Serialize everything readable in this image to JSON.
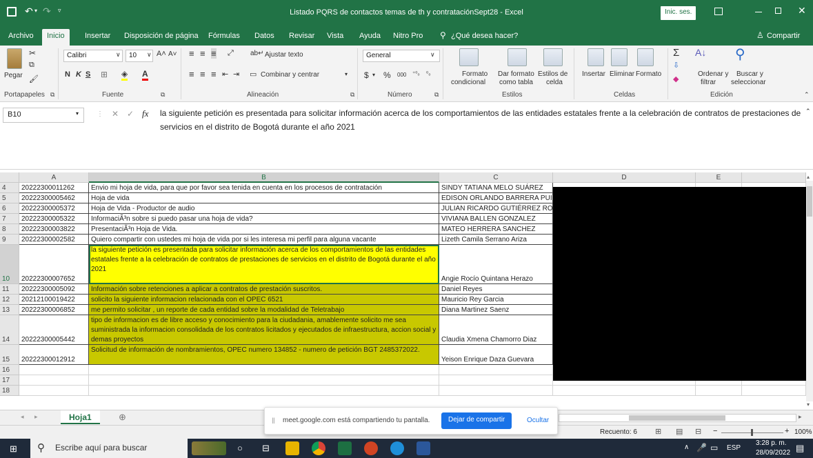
{
  "window": {
    "title": "Listado PQRS de contactos  temas de th y contrataciónSept28  -  Excel",
    "signin": "Inic. ses.",
    "share": "Compartir"
  },
  "tabs": [
    "Archivo",
    "Inicio",
    "Insertar",
    "Disposición de página",
    "Fórmulas",
    "Datos",
    "Revisar",
    "Vista",
    "Ayuda",
    "Nitro Pro",
    "¿Qué desea hacer?"
  ],
  "ribbon": {
    "paste": "Pegar",
    "font_name": "Calibri",
    "font_size": "10",
    "bold": "N",
    "italic": "K",
    "underline": "S",
    "wrap_text": "Ajustar texto",
    "merge_center": "Combinar y centrar",
    "number_format": "General",
    "currency": "$",
    "percent": "%",
    "thousands": "000",
    "cond_format": [
      "Formato",
      "condicional"
    ],
    "table_format": [
      "Dar formato",
      "como tabla"
    ],
    "cell_styles": [
      "Estilos de",
      "celda"
    ],
    "insert": "Insertar",
    "delete": "Eliminar",
    "format": "Formato",
    "sort": [
      "Ordenar y",
      "filtrar"
    ],
    "find": [
      "Buscar y",
      "seleccionar"
    ],
    "groups": [
      "Portapapeles",
      "Fuente",
      "Alineación",
      "Número",
      "Estilos",
      "Celdas",
      "Edición"
    ]
  },
  "formula_bar": {
    "name_box": "B10",
    "fx": "fx",
    "content": "la siguiente petición es presentada para solicitar información acerca de los comportamientos de las entidades estatales frente a la celebración de contratos de prestaciones de servicios en el distrito de Bogotá durante el año 2021"
  },
  "grid": {
    "columns": [
      "A",
      "B",
      "C",
      "D",
      "E"
    ],
    "rows": [
      {
        "n": "4",
        "a": "20222300011262",
        "b": "Envio mi hoja de vida, para que por favor sea tenida en cuenta en los procesos de contratación",
        "c": "SINDY TATIANA MELO SUÁREZ"
      },
      {
        "n": "5",
        "a": "20222300005462",
        "b": "Hoja de vida",
        "c": "EDISON ORLANDO BARRERA PUIN"
      },
      {
        "n": "6",
        "a": "20222300005372",
        "b": "Hoja de Vida - Productor de audio",
        "c": "JULIAN RICARDO GUTIÉRREZ RODRÍ"
      },
      {
        "n": "7",
        "a": "20222300005322",
        "b": "InformaciÃ³n sobre si puedo pasar una hoja de vida?",
        "c": "VIVIANA BALLEN GONZALEZ"
      },
      {
        "n": "8",
        "a": "20222300003822",
        "b": "PresentaciÃ³n Hoja de Vida.",
        "c": "MATEO HERRERA SANCHEZ"
      },
      {
        "n": "9",
        "a": "20222300002582",
        "b": "Quiero compartir con ustedes mi hoja de vida por si les interesa mi perfil para alguna vacante",
        "c": "Lizeth Camila Serrano Ariza"
      },
      {
        "n": "10",
        "a": "20222300007652",
        "b": "la siguiente petición es presentada para solicitar información acerca de los comportamientos de las entidades estatales frente a la celebración de contratos de prestaciones de servicios en el distrito de Bogotá durante el año 2021",
        "c": "Angie Rocío Quintana Herazo"
      },
      {
        "n": "11",
        "a": "20222300005092",
        "b": "Información sobre retenciones a aplicar a contratos de prestación suscritos.",
        "c": "Daniel Reyes"
      },
      {
        "n": "12",
        "a": "20212100019422",
        "b": "solicito la siguiente informacion relacionada con el OPEC 6521",
        "c": "Mauricio Rey Garcia"
      },
      {
        "n": "13",
        "a": "20222300006852",
        "b": "me permito solicitar , un reporte de cada entidad sobre la modalidad de Teletrabajo",
        "c": "Diana Martinez Saenz"
      },
      {
        "n": "14",
        "a": "20222300005442",
        "b": "tipo de informacion es de libre acceso y conocimiento para la ciudadania, amablemente solicito me sea suministrada la informacion consolidada de los contratos licitados y ejecutados de infraestructura, accion social y demas proyectos",
        "c": "Claudia Xmena Chamorro Diaz"
      },
      {
        "n": "15",
        "a": "20222300012912",
        "b": "Solicitud de información de nombramientos, OPEC numero 134852 - numero de petición BGT 2485372022.",
        "c": "Yeison Enrique Daza Guevara"
      },
      {
        "n": "16",
        "a": "",
        "b": "",
        "c": ""
      },
      {
        "n": "17",
        "a": "",
        "b": "",
        "c": ""
      },
      {
        "n": "18",
        "a": "",
        "b": "",
        "c": ""
      }
    ]
  },
  "sheet_tab": "Hoja1",
  "share_bar": {
    "message": "meet.google.com está compartiendo tu pantalla.",
    "stop": "Dejar de compartir",
    "hide": "Ocultar"
  },
  "status": {
    "count": "Recuento: 6",
    "zoom": "100%"
  },
  "taskbar": {
    "search": "Escribe aquí para buscar",
    "lang": "ESP",
    "time": "3:28 p. m.",
    "date": "28/09/2022"
  },
  "colors": {
    "excel_green": "#217346",
    "cell_yellow": "#ffff00",
    "cell_olive": "#c8c800",
    "share_blue": "#1a73e8"
  }
}
